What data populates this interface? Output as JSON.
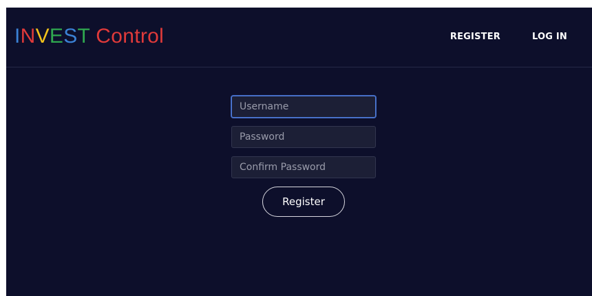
{
  "brand": {
    "parts": [
      {
        "text": "I",
        "color": "#3b82d6"
      },
      {
        "text": "N",
        "color": "#e03a3a"
      },
      {
        "text": "V",
        "color": "#f2c21b"
      },
      {
        "text": "E",
        "color": "#2fa84f"
      },
      {
        "text": "S",
        "color": "#3b82d6"
      },
      {
        "text": "T",
        "color": "#2fa84f"
      },
      {
        "text": " Control",
        "color": "#e03a3a"
      }
    ]
  },
  "nav": {
    "register_label": "REGISTER",
    "login_label": "LOG IN"
  },
  "form": {
    "username_placeholder": "Username",
    "password_placeholder": "Password",
    "confirm_placeholder": "Confirm Password",
    "submit_label": "Register"
  },
  "colors": {
    "background": "#0d0f2b",
    "field_background": "#1c1f36",
    "focus_border": "#4f7bd9"
  }
}
